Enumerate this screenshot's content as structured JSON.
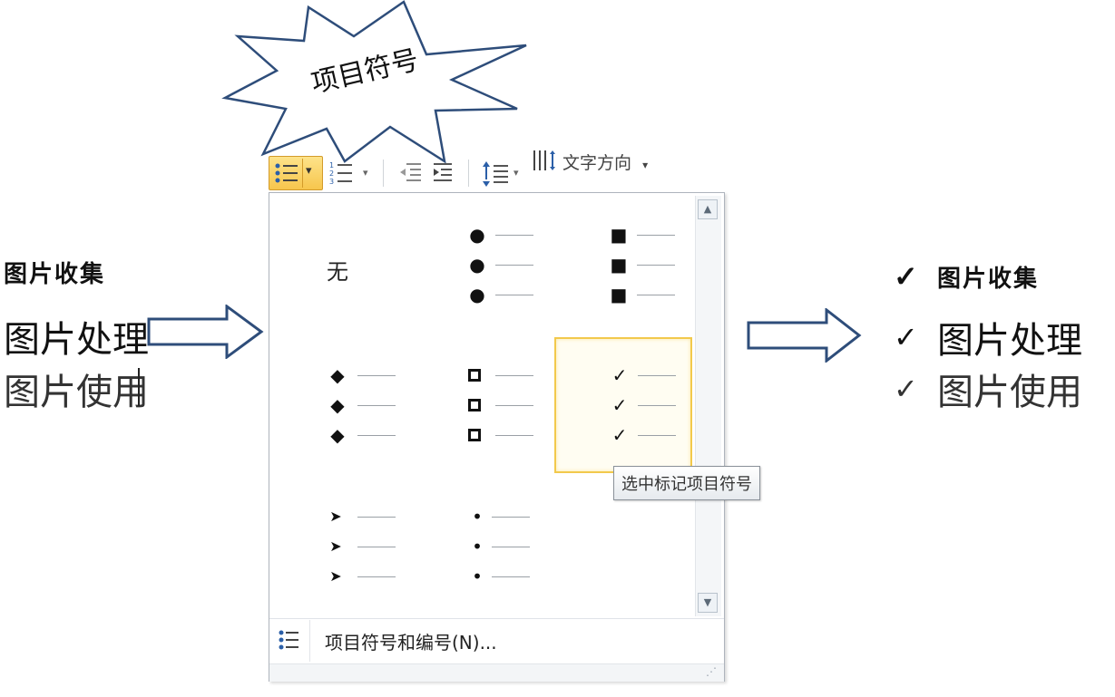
{
  "callout": {
    "label": "项目符号"
  },
  "left_text": {
    "line1": "图片收集",
    "line2": "图片处理",
    "line3": "图片使用"
  },
  "right_text": {
    "check": "✓",
    "line1": "图片收集",
    "line2": "图片处理",
    "line3": "图片使用"
  },
  "toolbar": {
    "text_direction_label": "文字方向",
    "dropdown_arrow": "▾"
  },
  "gallery": {
    "none_label": "无",
    "bullets": [
      {
        "name": "none",
        "mark": ""
      },
      {
        "name": "filled-circle",
        "mark": "●"
      },
      {
        "name": "filled-square",
        "mark": "■"
      },
      {
        "name": "filled-diamond",
        "mark": "◆"
      },
      {
        "name": "hollow-square",
        "mark": "❑"
      },
      {
        "name": "checkmark",
        "mark": "✓"
      },
      {
        "name": "arrowhead",
        "mark": "➤"
      },
      {
        "name": "small-dot",
        "mark": "•"
      }
    ],
    "tooltip": "选中标记项目符号",
    "footer_label": "项目符号和编号(N)...",
    "selected": "checkmark"
  },
  "colors": {
    "accent_border": "#f2c94c",
    "button_fill": "#f7c64d",
    "arrow_stroke": "#2e4d7a",
    "footer_icon": "#2b5fa8"
  },
  "icons": {
    "bullet_list": "bullet-list-icon",
    "numbered_list": "numbered-list-icon",
    "decrease_indent": "decrease-indent-icon",
    "increase_indent": "increase-indent-icon",
    "line_spacing": "line-spacing-icon",
    "text_direction": "text-direction-icon"
  }
}
